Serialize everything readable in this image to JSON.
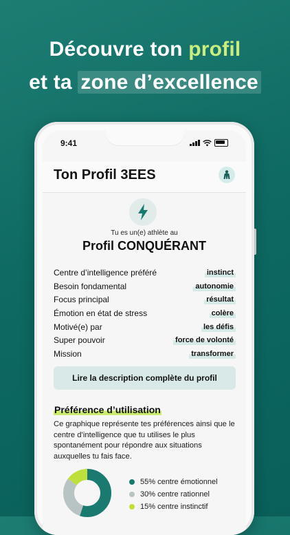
{
  "headline": {
    "line1_prefix": "Découvre ton ",
    "line1_highlight": "profil",
    "line2_prefix": "et ta ",
    "line2_highlight": "zone d’excellence"
  },
  "status": {
    "time": "9:41"
  },
  "header": {
    "title": "Ton Profil 3EES",
    "profile_icon": "athlete-icon"
  },
  "profile": {
    "icon": "lightning-bolt-icon",
    "pre_text": "Tu es un(e) athlète au",
    "name": "Profil CONQUÉRANT"
  },
  "attributes": [
    {
      "label": "Centre d’intelligence préféré",
      "value": "instinct"
    },
    {
      "label": "Besoin fondamental",
      "value": "autonomie"
    },
    {
      "label": "Focus principal",
      "value": "résultat"
    },
    {
      "label": "Émotion en état de stress",
      "value": "colère"
    },
    {
      "label": "Motivé(e) par",
      "value": "les défis"
    },
    {
      "label": "Super pouvoir",
      "value": "force de volonté"
    },
    {
      "label": "Mission",
      "value": "transformer"
    }
  ],
  "cta_label": "Lire la description complète du profil",
  "preference": {
    "title": "Préférence d’utilisation",
    "description": "Ce graphique représente tes préférences ainsi que le centre d’intelligence que tu utilises le plus spontanément pour répondre aux situations auxquelles tu fais face."
  },
  "chart_data": {
    "type": "pie",
    "series": [
      {
        "name": "55% centre émotionnel",
        "value": 55,
        "color": "#1b7a70"
      },
      {
        "name": "30% centre rationnel",
        "value": 30,
        "color": "#b8c4c3"
      },
      {
        "name": "15% centre instinctif",
        "value": 15,
        "color": "#bde03d"
      }
    ]
  },
  "colors": {
    "accent": "#1b7a70",
    "highlight": "#c9ee7e",
    "chip_bg": "#d5e9e7"
  }
}
